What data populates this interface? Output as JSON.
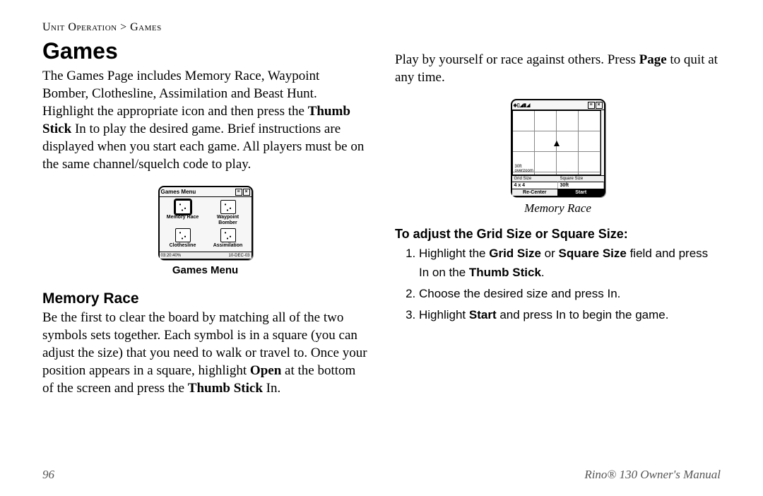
{
  "breadcrumb": "Unit Operation > Games",
  "title": "Games",
  "intro_parts": {
    "p1a": "The Games Page includes Memory Race, Waypoint Bomber, Clothesline, Assimilation and Beast Hunt. Highlight the appropriate icon and then press the ",
    "p1b": "Thumb Stick",
    "p1c": " In to play the desired game. Brief instructions are displayed when you start each game. All players must be on the same channel/squelch code to play."
  },
  "games_menu": {
    "title": "Games Menu",
    "items": [
      "Memory Race",
      "Waypoint Bomber",
      "Clothesline",
      "Assimilation"
    ],
    "status_left": "03:20:40%",
    "status_right": "10-DEC-03",
    "caption": "Games Menu"
  },
  "memory_race": {
    "heading": "Memory Race",
    "body_parts": {
      "a": "Be the first to clear the board by matching all of the two symbols sets together. Each symbol is in a square (you can adjust the size) that you need to walk or travel to. Once your position appears in a square, highlight ",
      "b": "Open",
      "c": " at the bottom of the screen and press the ",
      "d": "Thumb Stick",
      "e": " In."
    }
  },
  "right_top": {
    "a": "Play by yourself or race against others. Press ",
    "b": "Page",
    "c": " to quit at any time."
  },
  "mr_fig": {
    "scale": "30ft",
    "overzoom": "overzoom",
    "grid_label": "Grid Size",
    "grid_value": "4 x 4",
    "square_label": "Square Size",
    "square_value": "30ft",
    "recenter": "Re-Center",
    "start": "Start",
    "caption": "Memory Race"
  },
  "adjust": {
    "heading": "To adjust the Grid Size or Square Size:",
    "step1": {
      "a": "Highlight the ",
      "b": "Grid Size",
      "c": " or ",
      "d": "Square Size",
      "e": " field and press In on the ",
      "f": "Thumb Stick",
      "g": "."
    },
    "step2": "Choose the desired size and press In.",
    "step3": {
      "a": "Highlight ",
      "b": "Start",
      "c": " and press In to begin the game."
    }
  },
  "footer": {
    "page": "96",
    "manual": "Rino® 130 Owner's Manual"
  }
}
